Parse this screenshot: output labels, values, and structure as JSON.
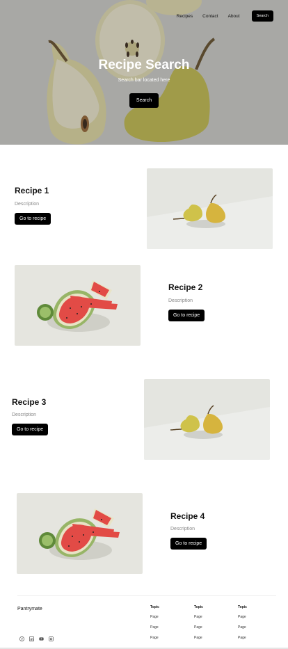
{
  "nav": {
    "links": [
      "Recipes",
      "Contact",
      "About"
    ],
    "search_label": "Search"
  },
  "hero": {
    "title": "Recipe Search",
    "subtitle": "Search bar located here",
    "button_label": "Search"
  },
  "recipes": [
    {
      "title": "Recipe 1",
      "description": "Description",
      "button": "Go to recipe",
      "photo": "pears"
    },
    {
      "title": "Recipe 2",
      "description": "Description",
      "button": "Go to recipe",
      "photo": "watermelon"
    },
    {
      "title": "Recipe 3",
      "description": "Description",
      "button": "Go to recipe",
      "photo": "pears"
    },
    {
      "title": "Recipe 4",
      "description": "Description",
      "button": "Go to recipe",
      "photo": "watermelon"
    }
  ],
  "footer": {
    "brand": "Pantrymate",
    "social_icons": [
      "facebook-icon",
      "linkedin-icon",
      "youtube-icon",
      "instagram-icon"
    ],
    "columns": [
      {
        "topic": "Topic",
        "pages": [
          "Page",
          "Page",
          "Page"
        ]
      },
      {
        "topic": "Topic",
        "pages": [
          "Page",
          "Page",
          "Page"
        ]
      },
      {
        "topic": "Topic",
        "pages": [
          "Page",
          "Page",
          "Page"
        ]
      }
    ]
  },
  "colors": {
    "accent": "#000000",
    "pear": "#cfc55a",
    "watermelon": "#e8433e"
  }
}
